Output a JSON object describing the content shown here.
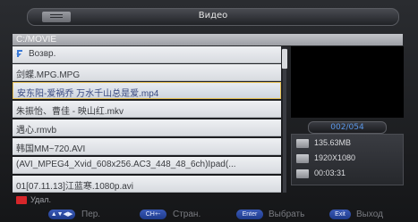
{
  "window": {
    "title": "Видео"
  },
  "path": "C:/MOVIE",
  "files": [
    {
      "name": "Возвр.",
      "type": "up"
    },
    {
      "name": "剑蝶.MPG.MPG",
      "type": "file"
    },
    {
      "name": "安东阳-爱祸乔 万水千山总是爱.mp4",
      "type": "file",
      "selected": true
    },
    {
      "name": "朱振怡、曹佳 - 映山红.mkv",
      "type": "file"
    },
    {
      "name": "遇心.rmvb",
      "type": "file"
    },
    {
      "name": "韩国MM~720.AVI",
      "type": "file"
    },
    {
      "name": "(AVI_MPEG4_Xvid_608x256.AC3_448_48_6ch)Ipad(...",
      "type": "file"
    },
    {
      "name": "01[07.11.13]江蓝寒.1080p.avi",
      "type": "file"
    }
  ],
  "preview": {
    "counter": "002/054",
    "size": "135.63MB",
    "resolution": "1920X1080",
    "duration": "00:03:31"
  },
  "delete_label": "Удал.",
  "help": [
    {
      "key": "▲▼◀▶",
      "label": "Пер."
    },
    {
      "key": "CH+-",
      "label": "Стран."
    },
    {
      "key": "Enter",
      "label": "Выбрать"
    },
    {
      "key": "Exit",
      "label": "Выход"
    }
  ],
  "colors": {
    "selection_border": "#e8c35a",
    "counter_text": "#5a96e6",
    "red_key": "#d6262a",
    "help_key": "#2a4aa0"
  }
}
